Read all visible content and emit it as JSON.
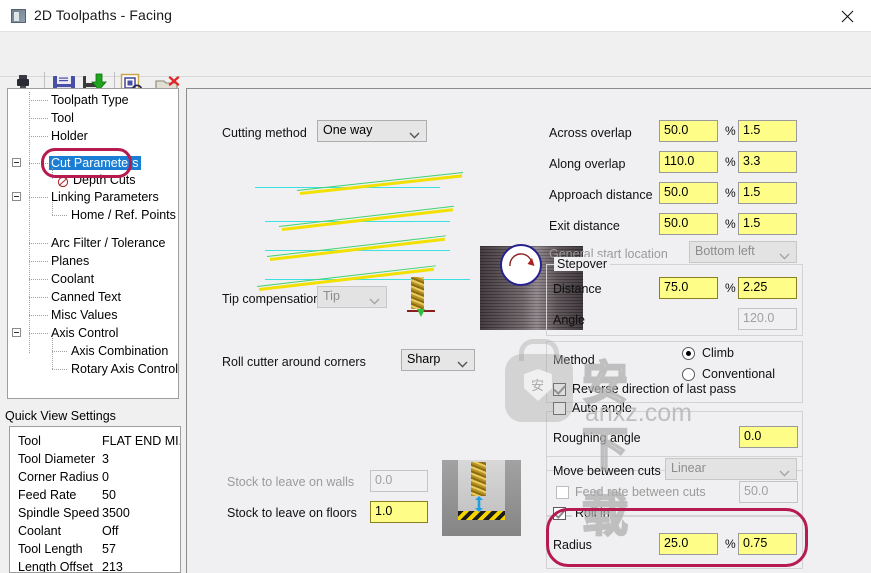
{
  "window": {
    "title": "2D Toolpaths - Facing",
    "icon": "app-icon",
    "close_label": "✕"
  },
  "toolbar": {
    "items": [
      {
        "name": "tool-icon",
        "label": "Tool"
      },
      {
        "name": "save-icon",
        "label": "Save"
      },
      {
        "name": "import-icon",
        "label": "Import"
      },
      {
        "name": "select-icon",
        "label": "Select"
      },
      {
        "name": "delete-folder-icon",
        "label": "Delete"
      }
    ]
  },
  "tree": {
    "items": [
      {
        "label": "Toolpath Type",
        "selected": false,
        "expandable": false
      },
      {
        "label": "Tool",
        "selected": false,
        "expandable": false
      },
      {
        "label": "Holder",
        "selected": false,
        "expandable": false
      },
      {
        "label": "Cut Parameters",
        "selected": true,
        "expandable": true
      },
      {
        "label": "Depth Cuts",
        "selected": false,
        "expandable": false
      },
      {
        "label": "Linking Parameters",
        "selected": false,
        "expandable": true
      },
      {
        "label": "Home / Ref. Points",
        "selected": false,
        "expandable": false
      },
      {
        "label": "Arc Filter / Tolerance",
        "selected": false,
        "expandable": false
      },
      {
        "label": "Planes",
        "selected": false,
        "expandable": false
      },
      {
        "label": "Coolant",
        "selected": false,
        "expandable": false
      },
      {
        "label": "Canned Text",
        "selected": false,
        "expandable": false
      },
      {
        "label": "Misc Values",
        "selected": false,
        "expandable": false
      },
      {
        "label": "Axis Control",
        "selected": false,
        "expandable": true
      },
      {
        "label": "Axis Combination",
        "selected": false,
        "expandable": false
      },
      {
        "label": "Rotary Axis Control",
        "selected": false,
        "expandable": false
      }
    ]
  },
  "quick_view": {
    "title": "Quick View Settings",
    "rows": [
      {
        "key": "Tool",
        "value": "FLAT END MI..."
      },
      {
        "key": "Tool Diameter",
        "value": "3"
      },
      {
        "key": "Corner Radius",
        "value": "0"
      },
      {
        "key": "Feed Rate",
        "value": "50"
      },
      {
        "key": "Spindle Speed",
        "value": "3500"
      },
      {
        "key": "Coolant",
        "value": "Off"
      },
      {
        "key": "Tool Length",
        "value": "57"
      },
      {
        "key": "Length Offset",
        "value": "213"
      }
    ]
  },
  "center": {
    "cutting_method_label": "Cutting method",
    "cutting_method_value": "One way",
    "tip_compensation_label": "Tip compensation",
    "tip_compensation_value": "Tip",
    "roll_cutter_label": "Roll cutter around corners",
    "roll_cutter_value": "Sharp",
    "stock_walls_label": "Stock to leave on walls",
    "stock_walls_value": "0.0",
    "stock_floors_label": "Stock to leave on floors",
    "stock_floors_value": "1.0"
  },
  "right": {
    "across_overlap_label": "Across overlap",
    "across_overlap_pct": "50.0",
    "across_overlap_val": "1.5",
    "along_overlap_label": "Along overlap",
    "along_overlap_pct": "110.0",
    "along_overlap_val": "3.3",
    "approach_distance_label": "Approach distance",
    "approach_distance_pct": "50.0",
    "approach_distance_val": "1.5",
    "exit_distance_label": "Exit distance",
    "exit_distance_pct": "50.0",
    "exit_distance_val": "1.5",
    "general_start_label": "General start location",
    "general_start_value": "Bottom left",
    "percent_symbol": "%",
    "stepover": {
      "title": "Stepover",
      "distance_label": "Distance",
      "distance_pct": "75.0",
      "distance_val": "2.25",
      "angle_label": "Angle",
      "angle_val": "120.0"
    },
    "method": {
      "label": "Method",
      "climb_label": "Climb",
      "conventional_label": "Conventional",
      "climb_selected": true,
      "reverse_label": "Reverse direction of last pass",
      "reverse_checked": true
    },
    "auto_angle": {
      "auto_angle_label": "Auto angle",
      "auto_angle_checked": false,
      "roughing_angle_label": "Roughing angle",
      "roughing_angle_val": "0.0"
    },
    "move_between": {
      "label": "Move between cuts",
      "value": "Linear",
      "feed_rate_label": "Feed rate between cuts",
      "feed_rate_checked": false,
      "feed_rate_val": "50.0"
    },
    "roll_in": {
      "label": "Roll in",
      "checked": true,
      "radius_label": "Radius",
      "radius_pct": "25.0",
      "radius_val": "0.75"
    }
  },
  "watermark": {
    "main": "安下载",
    "sub": "anxz.com",
    "badge": "安"
  },
  "colors": {
    "accent_blue": "#1a7fd4",
    "annotation_red": "#b51a50",
    "input_yellow": "#fdfd87",
    "panel_bg": "#f0eff1"
  }
}
